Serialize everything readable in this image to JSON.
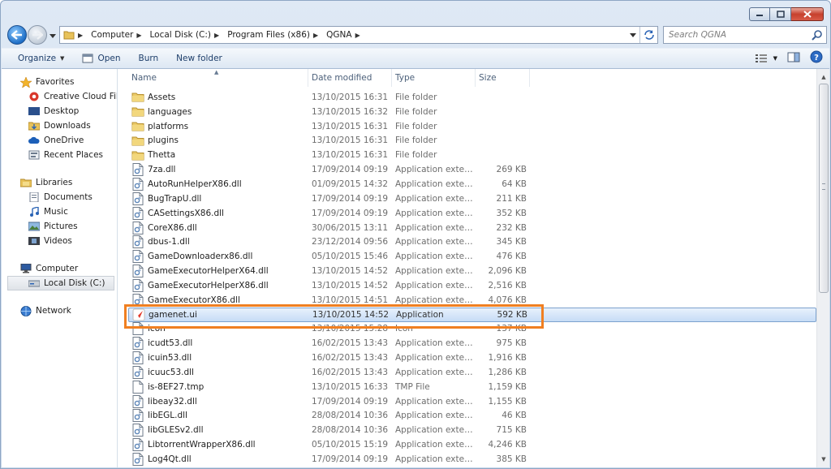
{
  "window": {
    "minimize_icon": "minimize-icon",
    "maximize_icon": "maximize-icon",
    "close_icon": "close-icon"
  },
  "address": {
    "crumbs": [
      "Computer",
      "Local Disk (C:)",
      "Program Files (x86)",
      "QGNA"
    ],
    "search_placeholder": "Search QGNA"
  },
  "toolbar": {
    "organize": "Organize",
    "open": "Open",
    "burn": "Burn",
    "new_folder": "New folder"
  },
  "nav": {
    "favorites": {
      "label": "Favorites",
      "items": [
        "Creative Cloud Files",
        "Desktop",
        "Downloads",
        "OneDrive",
        "Recent Places"
      ]
    },
    "libraries": {
      "label": "Libraries",
      "items": [
        "Documents",
        "Music",
        "Pictures",
        "Videos"
      ]
    },
    "computer": {
      "label": "Computer",
      "items": [
        "Local Disk (C:)"
      ]
    },
    "network": {
      "label": "Network"
    }
  },
  "columns": {
    "name": "Name",
    "date": "Date modified",
    "type": "Type",
    "size": "Size"
  },
  "files": [
    {
      "name": "Assets",
      "date": "13/10/2015 16:31",
      "type": "File folder",
      "size": "",
      "icon": "folder"
    },
    {
      "name": "languages",
      "date": "13/10/2015 16:32",
      "type": "File folder",
      "size": "",
      "icon": "folder"
    },
    {
      "name": "platforms",
      "date": "13/10/2015 16:31",
      "type": "File folder",
      "size": "",
      "icon": "folder"
    },
    {
      "name": "plugins",
      "date": "13/10/2015 16:31",
      "type": "File folder",
      "size": "",
      "icon": "folder"
    },
    {
      "name": "Thetta",
      "date": "13/10/2015 16:31",
      "type": "File folder",
      "size": "",
      "icon": "folder"
    },
    {
      "name": "7za.dll",
      "date": "17/09/2014 09:19",
      "type": "Application extens...",
      "size": "269 KB",
      "icon": "dll"
    },
    {
      "name": "AutoRunHelperX86.dll",
      "date": "01/09/2015 14:32",
      "type": "Application extens...",
      "size": "64 KB",
      "icon": "dll"
    },
    {
      "name": "BugTrapU.dll",
      "date": "17/09/2014 09:19",
      "type": "Application extens...",
      "size": "211 KB",
      "icon": "dll"
    },
    {
      "name": "CASettingsX86.dll",
      "date": "17/09/2014 09:19",
      "type": "Application extens...",
      "size": "352 KB",
      "icon": "dll"
    },
    {
      "name": "CoreX86.dll",
      "date": "30/06/2015 13:11",
      "type": "Application extens...",
      "size": "232 KB",
      "icon": "dll"
    },
    {
      "name": "dbus-1.dll",
      "date": "23/12/2014 09:56",
      "type": "Application extens...",
      "size": "345 KB",
      "icon": "dll"
    },
    {
      "name": "GameDownloaderx86.dll",
      "date": "05/10/2015 15:46",
      "type": "Application extens...",
      "size": "476 KB",
      "icon": "dll"
    },
    {
      "name": "GameExecutorHelperX64.dll",
      "date": "13/10/2015 14:52",
      "type": "Application extens...",
      "size": "2,096 KB",
      "icon": "dll"
    },
    {
      "name": "GameExecutorHelperX86.dll",
      "date": "13/10/2015 14:52",
      "type": "Application extens...",
      "size": "2,516 KB",
      "icon": "dll"
    },
    {
      "name": "GameExecutorX86.dll",
      "date": "13/10/2015 14:51",
      "type": "Application extens...",
      "size": "4,076 KB",
      "icon": "dll"
    },
    {
      "name": "gamenet.ui",
      "date": "13/10/2015 14:52",
      "type": "Application",
      "size": "592 KB",
      "icon": "app"
    },
    {
      "name": "icon",
      "date": "13/10/2015 15:28",
      "type": "Icon",
      "size": "137 KB",
      "icon": "file"
    },
    {
      "name": "icudt53.dll",
      "date": "16/02/2015 13:43",
      "type": "Application extens...",
      "size": "975 KB",
      "icon": "dll"
    },
    {
      "name": "icuin53.dll",
      "date": "16/02/2015 13:43",
      "type": "Application extens...",
      "size": "1,916 KB",
      "icon": "dll"
    },
    {
      "name": "icuuc53.dll",
      "date": "16/02/2015 13:43",
      "type": "Application extens...",
      "size": "1,286 KB",
      "icon": "dll"
    },
    {
      "name": "is-8EF27.tmp",
      "date": "13/10/2015 16:33",
      "type": "TMP File",
      "size": "1,159 KB",
      "icon": "file"
    },
    {
      "name": "libeay32.dll",
      "date": "17/09/2014 09:19",
      "type": "Application extens...",
      "size": "1,155 KB",
      "icon": "dll"
    },
    {
      "name": "libEGL.dll",
      "date": "28/08/2014 10:36",
      "type": "Application extens...",
      "size": "46 KB",
      "icon": "dll"
    },
    {
      "name": "libGLESv2.dll",
      "date": "28/08/2014 10:36",
      "type": "Application extens...",
      "size": "715 KB",
      "icon": "dll"
    },
    {
      "name": "LibtorrentWrapperX86.dll",
      "date": "05/10/2015 15:19",
      "type": "Application extens...",
      "size": "4,246 KB",
      "icon": "dll"
    },
    {
      "name": "Log4Qt.dll",
      "date": "17/09/2014 09:19",
      "type": "Application extens...",
      "size": "385 KB",
      "icon": "dll"
    }
  ],
  "selected_file": "gamenet.ui",
  "colors": {
    "highlight": "#f07f21",
    "selection": "#c6dcf6",
    "accent": "#1f6fc7"
  }
}
